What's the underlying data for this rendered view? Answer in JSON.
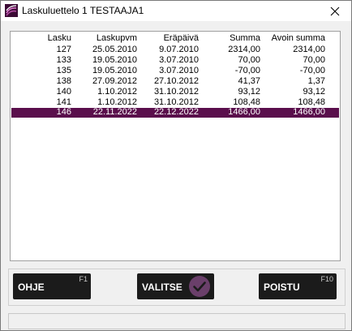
{
  "window": {
    "title": "Laskuluettelo 1 TESTAAJA1",
    "close_glyph": "✕"
  },
  "table": {
    "headers": [
      "Lasku",
      "Laskupvm",
      "Eräpäivä",
      "Summa",
      "Avoin summa"
    ],
    "rows": [
      [
        "127",
        "25.05.2010",
        "9.07.2010",
        "2314,00",
        "2314,00"
      ],
      [
        "133",
        "19.05.2010",
        "3.07.2010",
        "70,00",
        "70,00"
      ],
      [
        "135",
        "19.05.2010",
        "3.07.2010",
        "-70,00",
        "-70,00"
      ],
      [
        "138",
        "27.09.2012",
        "27.10.2012",
        "41,37",
        "1,37"
      ],
      [
        "140",
        "1.10.2012",
        "31.10.2012",
        "93,12",
        "93,12"
      ],
      [
        "141",
        "1.10.2012",
        "31.10.2012",
        "108,48",
        "108,48"
      ],
      [
        "146",
        "22.11.2022",
        "22.12.2022",
        "1466,00",
        "1466,00"
      ]
    ],
    "selected_row": "146"
  },
  "buttons": {
    "help": {
      "label": "OHJE",
      "key": "F1"
    },
    "select": {
      "label": "VALITSE",
      "icon": "check-circle-icon"
    },
    "exit": {
      "label": "POISTU",
      "key": "F10"
    }
  },
  "colors": {
    "selection": "#5a0e4c",
    "button_bg": "#1b1b1b",
    "check_circle": "#6a3f6a"
  },
  "status": {
    "text": ""
  }
}
